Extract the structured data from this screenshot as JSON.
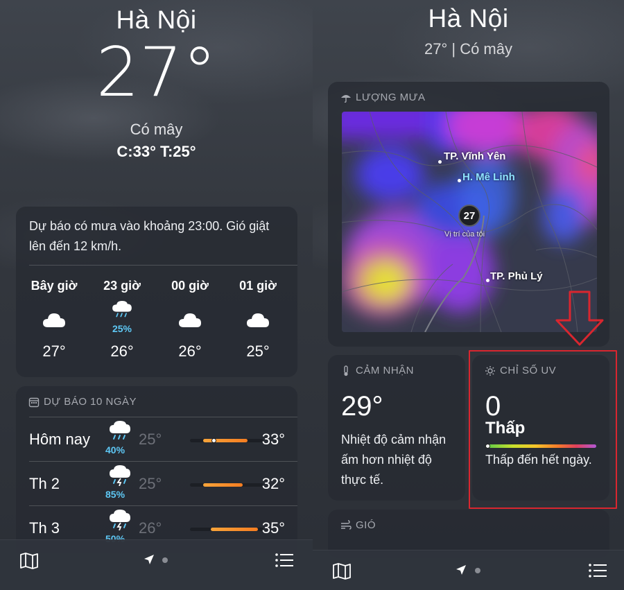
{
  "left": {
    "city": "Hà Nội",
    "temp": "27°",
    "condition": "Có mây",
    "hilo": "C:33°  T:25°",
    "hourly": {
      "summary": "Dự báo có mưa vào khoảng 23:00. Gió giật lên đến 12 km/h.",
      "hours": [
        {
          "label": "Bây giờ",
          "icon": "cloud-icon",
          "prob": "",
          "temp": "27°"
        },
        {
          "label": "23 giờ",
          "icon": "cloud-rain-icon",
          "prob": "25%",
          "temp": "26°"
        },
        {
          "label": "00 giờ",
          "icon": "cloud-icon",
          "prob": "",
          "temp": "26°"
        },
        {
          "label": "01 giờ",
          "icon": "cloud-icon",
          "prob": "",
          "temp": "25°"
        }
      ]
    },
    "tenday": {
      "title": "DỰ BÁO 10 NGÀY",
      "days": [
        {
          "name": "Hôm nay",
          "icon": "cloud-rain-icon",
          "prob": "40%",
          "low": "25°",
          "high": "33°",
          "range": [
            0.18,
            0.78
          ],
          "current": 0.32
        },
        {
          "name": "Th 2",
          "icon": "thunderstorm-icon",
          "prob": "85%",
          "low": "25°",
          "high": "32°",
          "range": [
            0.18,
            0.72
          ]
        },
        {
          "name": "Th 3",
          "icon": "thunderstorm-icon",
          "prob": "50%",
          "low": "26°",
          "high": "35°",
          "range": [
            0.28,
            0.92
          ]
        }
      ]
    }
  },
  "right": {
    "city": "Hà Nội",
    "subline": "27°  |  Có mây",
    "rain": {
      "title": "LƯỢNG MƯA",
      "labels": {
        "vinh_yen": "TP. Vĩnh Yên",
        "me_linh": "H. Mê Linh",
        "phu_ly": "TP. Phủ Lý",
        "my_location": "Vị trí của tôi"
      },
      "my_temp": "27"
    },
    "feels": {
      "title": "CẢM NHẬN",
      "value": "29°",
      "desc": "Nhiệt độ cảm nhận ấm hơn nhiệt độ thực tế."
    },
    "uv": {
      "title": "CHỈ SỐ UV",
      "value": "0",
      "level": "Thấp",
      "bar_position": 0.0,
      "desc": "Thấp đến hết ngày."
    },
    "wind": {
      "title": "GIÓ"
    }
  },
  "colors": {
    "highlight": "#d9262f",
    "rain_prob": "#5ec8f5",
    "temp_bar": "#f57d21"
  }
}
